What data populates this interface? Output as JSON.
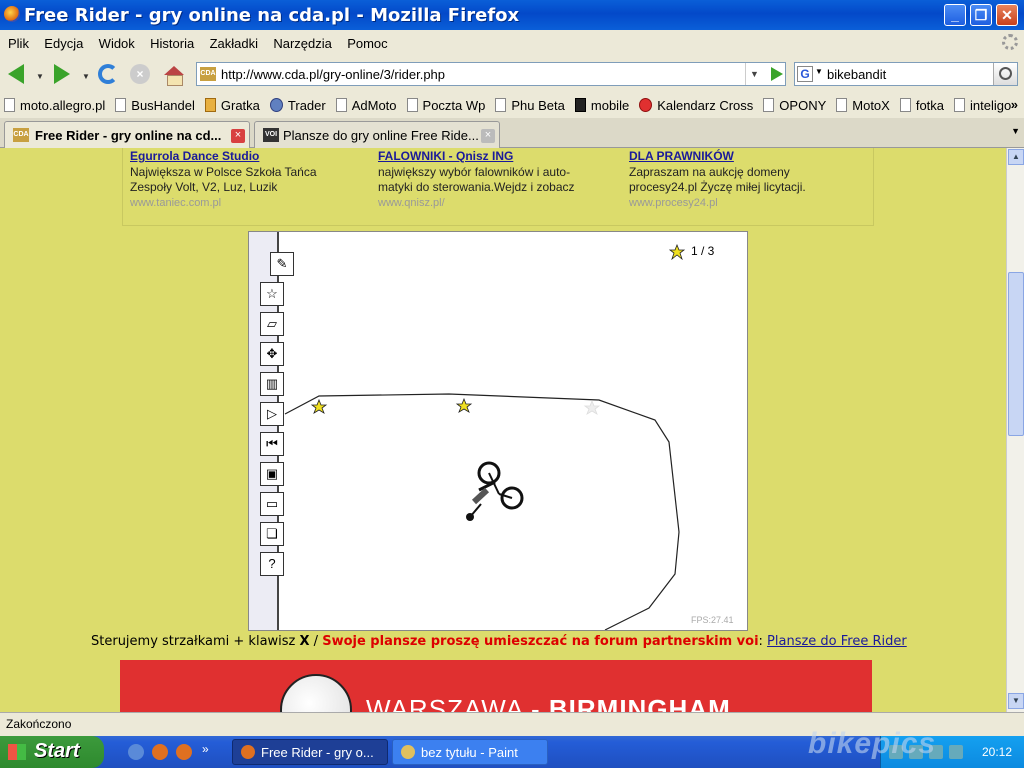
{
  "window": {
    "title": "Free Rider - gry online na cda.pl - Mozilla Firefox",
    "minimize_label": "_",
    "maximize_label": "❐",
    "close_label": "✕"
  },
  "menubar": [
    "Plik",
    "Edycja",
    "Widok",
    "Historia",
    "Zakładki",
    "Narzędzia",
    "Pomoc"
  ],
  "navbar": {
    "url": "http://www.cda.pl/gry-online/3/rider.php",
    "favicon_text": "CDA",
    "search_value": "bikebandit",
    "search_engine": "G"
  },
  "bookmarks": [
    {
      "label": "moto.allegro.pl",
      "icon": "plain"
    },
    {
      "label": "BusHandel",
      "icon": "plain"
    },
    {
      "label": "Gratka",
      "icon": "col"
    },
    {
      "label": "Trader",
      "icon": "blue"
    },
    {
      "label": "AdMoto",
      "icon": "plain"
    },
    {
      "label": "Poczta Wp",
      "icon": "plain"
    },
    {
      "label": "Phu Beta",
      "icon": "plain"
    },
    {
      "label": "mobile",
      "icon": "dark"
    },
    {
      "label": "Kalendarz Cross",
      "icon": "red"
    },
    {
      "label": "OPONY",
      "icon": "plain"
    },
    {
      "label": "MotoX",
      "icon": "plain"
    },
    {
      "label": "fotka",
      "icon": "plain"
    },
    {
      "label": "inteligo",
      "icon": "plain"
    }
  ],
  "bookmarks_more": "»",
  "tabs": [
    {
      "label": "Free Rider - gry online na cd...",
      "favicon": "CDA",
      "active": true
    },
    {
      "label": "Plansze do gry online Free Ride...",
      "favicon": "VOI",
      "active": false
    }
  ],
  "ads": [
    {
      "title": "Egurrola Dance Studio",
      "desc1": "Największa w Polsce Szkoła Tańca",
      "desc2": "Zespoły Volt, V2, Luz, Luzik",
      "url": "www.taniec.com.pl"
    },
    {
      "title": "FALOWNIKI - Qnisz ING",
      "desc1": "największy wybór falowników i auto-",
      "desc2": "matyki do sterowania.Wejdz i zobacz",
      "url": "www.qnisz.pl/"
    },
    {
      "title": "DLA PRAWNIKÓW",
      "desc1": "Zapraszam na aukcję domeny",
      "desc2": "procesy24.pl Życzę miłej licytacji.",
      "url": "www.procesy24.pl"
    }
  ],
  "game": {
    "star_count": "1 / 3",
    "fps": "FPS:27.41",
    "tools": [
      {
        "name": "pencil-tool",
        "glyph": "✎"
      },
      {
        "name": "star-tool",
        "glyph": "☆"
      },
      {
        "name": "eraser-tool",
        "glyph": "▱"
      },
      {
        "name": "move-tool",
        "glyph": "✥"
      },
      {
        "name": "trash-tool",
        "glyph": "▥"
      },
      {
        "name": "play-tool",
        "glyph": "▷"
      },
      {
        "name": "restart-tool",
        "glyph": "⏮"
      },
      {
        "name": "save-tool",
        "glyph": "▣"
      },
      {
        "name": "open-tool",
        "glyph": "▭"
      },
      {
        "name": "layers-tool",
        "glyph": "❏"
      },
      {
        "name": "help-tool",
        "glyph": "?"
      }
    ]
  },
  "instructions": {
    "part1": "Sterujemy strzałkami + klawisz ",
    "key": "X",
    "sep": " / ",
    "red": "Swoje plansze proszę umieszczać na forum partnerskim voi",
    "colon": ": ",
    "link": "Plansze do Free Rider"
  },
  "banner": {
    "text1": "WARSZAWA - ",
    "text2": "BIRMINGHAM"
  },
  "status": "Zakończono",
  "taskbar": {
    "start": "Start",
    "more": "»",
    "tasks": [
      {
        "label": "Free Rider - gry o...",
        "active": true
      },
      {
        "label": "bez tytułu - Paint",
        "active": false
      }
    ],
    "clock": "20:12"
  },
  "watermark": "bikepics",
  "colors": {
    "content_bg": "#dcdc6c",
    "titlebar": "#0a5fd8",
    "banner": "#e03030",
    "star": "#f0e020"
  }
}
